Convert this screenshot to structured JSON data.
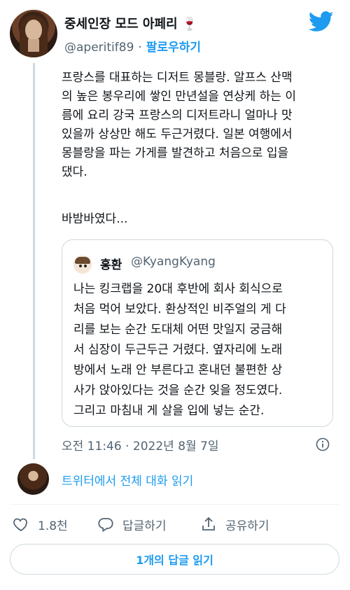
{
  "author": {
    "name": "중세인장 모드 아페리 🍷",
    "handle": "@aperitif89",
    "separator": "·",
    "follow_label": "팔로우하기"
  },
  "tweet": {
    "text": "프랑스를 대표하는 디저트 몽블랑. 알프스 산맥\n의 높은 봉우리에 쌓인 만년설을 연상케 하는 이\n름에 요리 강국 프랑스의 디저트라니 얼마나 맛\n있을까 상상만 해도 두근거렸다. 일본 여행에서\n몽블랑을 파는 가게를 발견하고 처음으로 입을\n댔다.",
    "text2": "바밤바였다...",
    "timestamp": "오전 11:46 · 2022년 8월 7일"
  },
  "quote": {
    "name": "홍환",
    "handle": "@KyangKyang",
    "text": "나는 킹크랩을 20대 후반에 회사 회식으로\n처음 먹어 보았다. 환상적인 비주얼의 게 다\n리를 보는 순간 도대체 어떤 맛일지 궁금해\n서 심장이 두근두근 거렸다. 옆자리에 노래\n방에서 노래 안 부른다고 혼내던 불편한 상\n사가 앉아있다는 것을 순간 잊을 정도였다.\n그리고 마침내 게 살을 입에 넣는 순간."
  },
  "conversation": {
    "read_label": "트위터에서 전체 대화 읽기"
  },
  "actions": {
    "like_count": "1.8천",
    "reply_label": "답글하기",
    "share_label": "공유하기"
  },
  "replies_button_label": "1개의 답글 읽기",
  "colors": {
    "accent": "#1d9bf0",
    "text": "#0f1419",
    "muted": "#536471",
    "border": "#cfd9de"
  },
  "icons": {
    "brand": "twitter-bird-icon",
    "info": "info-icon",
    "like": "heart-icon",
    "reply": "reply-bubble-icon",
    "share": "share-icon"
  }
}
